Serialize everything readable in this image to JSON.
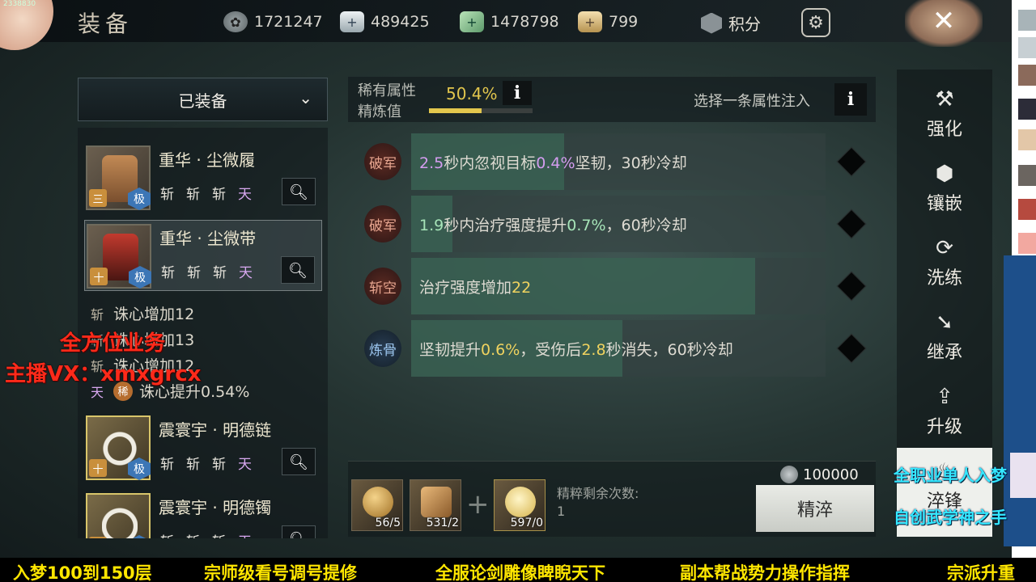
{
  "window": {
    "title": "装备",
    "corner_label": "2338830"
  },
  "currencies": [
    {
      "icon": "coin-icon",
      "value": "1721247"
    },
    {
      "icon": "silver-ingot-icon",
      "value": "489425"
    },
    {
      "icon": "jade-icon",
      "value": "1478798"
    },
    {
      "icon": "gold-ingot-icon",
      "value": "799"
    }
  ],
  "header": {
    "score_label": "积分",
    "close_glyph": "✕",
    "gear_glyph": "⚙"
  },
  "left": {
    "dropdown_label": "已装备",
    "items": [
      {
        "name": "重华 · 尘微履",
        "tier": "三",
        "grade": "极",
        "tags": [
          "斩",
          "斩",
          "斩",
          "天"
        ]
      },
      {
        "name": "重华 · 尘微带",
        "tier": "十",
        "grade": "极",
        "tags": [
          "斩",
          "斩",
          "斩",
          "天"
        ]
      },
      {
        "name": "震寰宇 · 明德链",
        "tier": "十",
        "grade": "极",
        "tags": [
          "斩",
          "斩",
          "斩",
          "天"
        ]
      },
      {
        "name": "震寰宇 · 明德镯",
        "tier": "十",
        "grade": "极",
        "tags": [
          "斩",
          "斩",
          "斩",
          "天"
        ]
      }
    ],
    "sublines": [
      {
        "k": "斩",
        "text": "诛心增加12"
      },
      {
        "k": "斩",
        "text": "诛心增加13"
      },
      {
        "k": "斩",
        "text": "诛心增加12"
      },
      {
        "k": "天",
        "xi": "稀",
        "text": "诛心提升0.54%"
      }
    ]
  },
  "refine": {
    "rare_label_1": "稀有属性",
    "rare_label_2": "精炼值",
    "percent": "50.4%",
    "percent_value": 0.504,
    "select_label": "选择一条属性注入",
    "info_glyph": "i"
  },
  "attributes": [
    {
      "badge": "破军",
      "badge_color": "red",
      "fill": 0.37,
      "pre": "",
      "a": "2.5",
      "mid1": "秒内忽视目标",
      "b": "0.4%",
      "post": "坚韧，30秒冷却",
      "hl": "purple"
    },
    {
      "badge": "破军",
      "badge_color": "red",
      "fill": 0.1,
      "pre": "",
      "a": "1.9",
      "mid1": "秒内治疗强度提升",
      "b": "0.7%",
      "post": "，60秒冷却",
      "hl": "green"
    },
    {
      "badge": "斩空",
      "badge_color": "red",
      "fill": 0.83,
      "pre": "治疗强度增加",
      "a": "22",
      "mid1": "",
      "b": "",
      "post": "",
      "hl": "yellow"
    },
    {
      "badge": "炼骨",
      "badge_color": "blue",
      "fill": 0.51,
      "pre": "坚韧提升",
      "a": "0.6%",
      "mid1": "，受伤后",
      "b": "2.8",
      "post": "秒消失，60秒冷却",
      "hl": "yellow"
    }
  ],
  "materials": [
    {
      "count": "56/5"
    },
    {
      "count": "531/2"
    },
    {
      "count": "597/0"
    }
  ],
  "bottom": {
    "plus": "+",
    "remaining_label": "精粹剩余次数:",
    "remaining_value": "1",
    "cost": "100000",
    "refine_button": "精淬"
  },
  "right_menu": [
    {
      "icon": "hammer-icon",
      "glyph": "⚒",
      "label": "强化"
    },
    {
      "icon": "gem-icon",
      "glyph": "⬢",
      "label": "镶嵌"
    },
    {
      "icon": "refresh-icon",
      "glyph": "⟳",
      "label": "洗练"
    },
    {
      "icon": "inherit-icon",
      "glyph": "➘",
      "label": "继承"
    },
    {
      "icon": "upgrade-icon",
      "glyph": "⇪",
      "label": "升级"
    },
    {
      "icon": "sharpen-icon",
      "glyph": "♨",
      "label": "淬锋"
    }
  ],
  "overlays": {
    "red_1": "全方位业务",
    "red_2": "主播VX：xmxgrcx",
    "cyan_1": "全职业单人入梦",
    "cyan_2": "自创武学神之手",
    "ticker": [
      "入梦100到150层",
      "宗师级看号调号提修",
      "全服论剑雕像睥睨天下",
      "副本帮战势力操作指挥",
      "宗派升重"
    ]
  },
  "colors": {
    "accent_gold": "#e2c64d",
    "highlight_purple": "#d49df0",
    "highlight_green": "#a6e4b8",
    "highlight_yellow": "#f0d35f",
    "overlay_red": "#ff2a1a",
    "overlay_cyan": "#34e8ff",
    "ticker_yellow": "#ffe600"
  }
}
